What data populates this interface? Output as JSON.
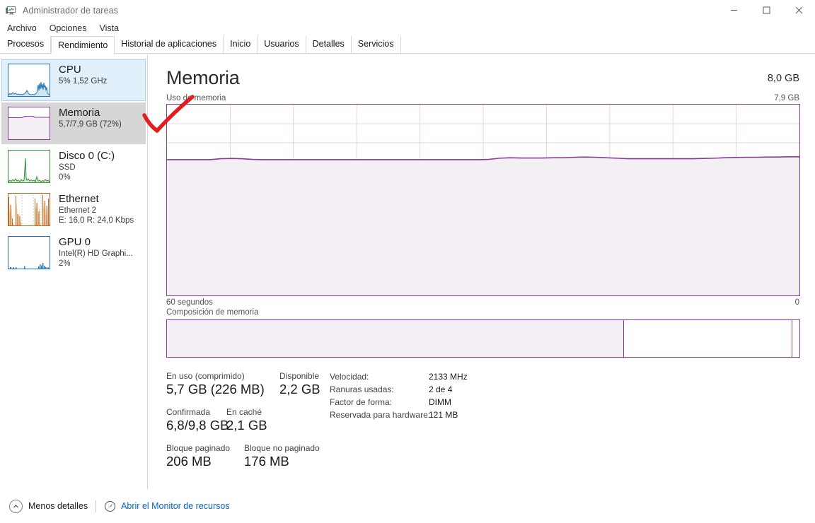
{
  "window": {
    "title": "Administrador de tareas",
    "icon": "task-manager-icon",
    "minimize": "—",
    "maximize": "☐",
    "close": "✕"
  },
  "menu": {
    "items": [
      {
        "label": "Archivo",
        "name": "menu-archivo"
      },
      {
        "label": "Opciones",
        "name": "menu-opciones"
      },
      {
        "label": "Vista",
        "name": "menu-vista"
      }
    ]
  },
  "tabs": [
    {
      "label": "Procesos",
      "active": false
    },
    {
      "label": "Rendimiento",
      "active": true
    },
    {
      "label": "Historial de aplicaciones",
      "active": false
    },
    {
      "label": "Inicio",
      "active": false
    },
    {
      "label": "Usuarios",
      "active": false
    },
    {
      "label": "Detalles",
      "active": false
    },
    {
      "label": "Servicios",
      "active": false
    }
  ],
  "sidebar": {
    "items": [
      {
        "key": "cpu",
        "title": "CPU",
        "sub1": "5%  1,52 GHz",
        "sub2": "",
        "color": "#1f77b4",
        "state": "focused"
      },
      {
        "key": "memoria",
        "title": "Memoria",
        "sub1": "5,7/7,9 GB (72%)",
        "sub2": "",
        "color": "#8a3a98",
        "state": "selected"
      },
      {
        "key": "disco0",
        "title": "Disco 0 (C:)",
        "sub1": "SSD",
        "sub2": "0%",
        "color": "#3a8a3a",
        "state": "normal"
      },
      {
        "key": "ethernet",
        "title": "Ethernet",
        "sub1": "Ethernet 2",
        "sub2": "E: 16,0 R: 24,0 Kbps",
        "color": "#b5651d",
        "state": "normal"
      },
      {
        "key": "gpu0",
        "title": "GPU 0",
        "sub1": "Intel(R) HD Graphi...",
        "sub2": "2%",
        "color": "#1f77b4",
        "state": "normal"
      }
    ]
  },
  "main": {
    "title": "Memoria",
    "total": "8,0 GB",
    "graph_label": "Uso de memoria",
    "graph_max": "7,9 GB",
    "axis_left": "60 segundos",
    "axis_right": "0",
    "composition_label": "Composición de memoria",
    "accent_color": "#8a3a98",
    "fill_color": "#f4eef5"
  },
  "stats": {
    "in_use_label": "En uso (comprimido)",
    "in_use_value": "5,7 GB (226 MB)",
    "available_label": "Disponible",
    "available_value": "2,2 GB",
    "committed_label": "Confirmada",
    "committed_value": "6,8/9,8 GB",
    "cached_label": "En caché",
    "cached_value": "2,1 GB",
    "paged_label": "Bloque paginado",
    "paged_value": "206 MB",
    "nonpaged_label": "Bloque no paginado",
    "nonpaged_value": "176 MB"
  },
  "hardware": {
    "rows": [
      {
        "label": "Velocidad:",
        "value": "2133 MHz"
      },
      {
        "label": "Ranuras usadas:",
        "value": "2 de 4"
      },
      {
        "label": "Factor de forma:",
        "value": "DIMM"
      },
      {
        "label": "Reservada para hardware:",
        "value": "121 MB"
      }
    ]
  },
  "statusbar": {
    "less_details": "Menos detalles",
    "resource_monitor": "Abrir el Monitor de recursos"
  },
  "chart_data": {
    "type": "area",
    "title": "Uso de memoria",
    "xlabel": "60 segundos",
    "ylabel": "",
    "ylim": [
      0,
      7.9
    ],
    "xlim": [
      60,
      0
    ],
    "grid": true,
    "unit": "GB",
    "series": [
      {
        "name": "Uso de memoria",
        "values": [
          5.62,
          5.62,
          5.62,
          5.62,
          5.62,
          5.66,
          5.67,
          5.66,
          5.63,
          5.62,
          5.62,
          5.62,
          5.62,
          5.62,
          5.62,
          5.62,
          5.62,
          5.62,
          5.62,
          5.62,
          5.62,
          5.62,
          5.62,
          5.62,
          5.62,
          5.62,
          5.62,
          5.62,
          5.62,
          5.62,
          5.63,
          5.68,
          5.7,
          5.69,
          5.69,
          5.69,
          5.7,
          5.7,
          5.72,
          5.73,
          5.72,
          5.7,
          5.68,
          5.66,
          5.66,
          5.66,
          5.66,
          5.66,
          5.66,
          5.66,
          5.67,
          5.68,
          5.7,
          5.71,
          5.72,
          5.72,
          5.73,
          5.73,
          5.74,
          5.74
        ]
      }
    ],
    "composition": {
      "type": "bar",
      "total_gb": 7.9,
      "segments": [
        {
          "name": "En uso",
          "gb": 5.7,
          "fill": "#f4eef5"
        },
        {
          "name": "Disponible",
          "gb": 2.1,
          "fill": "#ffffff"
        },
        {
          "name": "Reservada",
          "gb": 0.12,
          "fill": "#ffffff"
        }
      ]
    }
  }
}
